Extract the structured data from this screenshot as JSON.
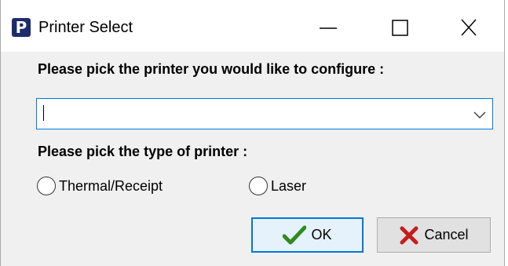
{
  "window": {
    "title": "Printer Select",
    "app_icon_letter": "P"
  },
  "printer_section": {
    "label": "Please pick the printer you would like to configure :",
    "combo_value": ""
  },
  "type_section": {
    "label": "Please pick the type of printer :",
    "options": [
      {
        "label": "Thermal/Receipt",
        "selected": false
      },
      {
        "label": "Laser",
        "selected": false
      }
    ]
  },
  "buttons": {
    "ok_label": "OK",
    "cancel_label": "Cancel"
  },
  "colors": {
    "focus_blue": "#0078d7",
    "ok_check_green": "#2e8b1e",
    "cancel_x_red": "#c41e1e",
    "app_icon_navy": "#1d2c6b"
  },
  "icons": {
    "app": "printer-app-icon",
    "minimize": "minimize-icon",
    "maximize": "maximize-icon",
    "close": "close-icon",
    "dropdown": "chevron-down-icon",
    "ok": "checkmark-icon",
    "cancel": "x-mark-icon"
  }
}
